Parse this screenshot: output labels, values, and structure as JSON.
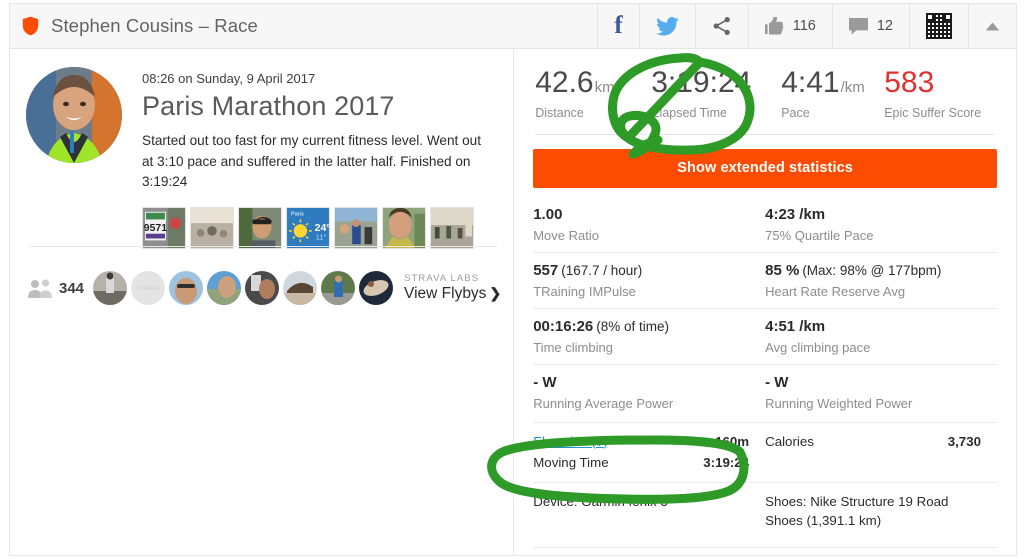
{
  "header": {
    "shield_icon": "shield-icon",
    "title": "Stephen Cousins – Race",
    "facebook_icon": "facebook-icon",
    "twitter_icon": "twitter-icon",
    "share_icon": "share-icon",
    "kudos_icon": "thumbs-up-icon",
    "kudos_count": "116",
    "comment_icon": "comment-icon",
    "comment_count": "12",
    "qr_icon": "qr-code-icon",
    "collapse_icon": "chevron-up-icon"
  },
  "activity": {
    "date": "08:26 on Sunday, 9 April 2017",
    "title": "Paris Marathon 2017",
    "description": "Started out too fast for my current fitness level. Went out at 3:10 pace and suffered in the latter half. Finished on 3:19:24",
    "avatar": "athlete-avatar",
    "photos": [
      {
        "name": "photo-race-bib"
      },
      {
        "name": "photo-street-crowd"
      },
      {
        "name": "photo-selfie-cap"
      },
      {
        "name": "photo-weather-widget"
      },
      {
        "name": "photo-runners"
      },
      {
        "name": "photo-medal-selfie"
      },
      {
        "name": "photo-finish-line"
      }
    ]
  },
  "flybys": {
    "people_icon": "people-icon",
    "count": "344",
    "avatars": [
      {
        "name": "flyby-avatar-1"
      },
      {
        "name": "flyby-avatar-2"
      },
      {
        "name": "flyby-avatar-3"
      },
      {
        "name": "flyby-avatar-4"
      },
      {
        "name": "flyby-avatar-5"
      },
      {
        "name": "flyby-avatar-6"
      },
      {
        "name": "flyby-avatar-7"
      },
      {
        "name": "flyby-avatar-8"
      }
    ],
    "kicker": "STRAVA LABS",
    "label": "View Flybys",
    "chevron": "❯"
  },
  "summary": [
    {
      "value": "42.6",
      "unit": "km",
      "label": "Distance",
      "red": false
    },
    {
      "value": "3:19:24",
      "unit": "",
      "label": "Elapsed Time",
      "red": false
    },
    {
      "value": "4:41",
      "unit": "/km",
      "label": "Pace",
      "red": false
    },
    {
      "value": "583",
      "unit": "",
      "label": "Epic Suffer Score",
      "red": true
    }
  ],
  "extended_button": "Show extended statistics",
  "stats": [
    [
      {
        "value": "1.00",
        "sub": "",
        "label": "Move Ratio"
      },
      {
        "value": "4:23 /km",
        "sub": "",
        "label": "75% Quartile Pace"
      }
    ],
    [
      {
        "value": "557",
        "sub": "(167.7 / hour)",
        "label": "TRaining IMPulse"
      },
      {
        "value": "85 %",
        "sub": "(Max: 98% @ 177bpm)",
        "label": "Heart Rate Reserve Avg"
      }
    ],
    [
      {
        "value": "00:16:26",
        "sub": "(8% of time)",
        "label": "Time climbing"
      },
      {
        "value": "4:51 /km",
        "sub": "",
        "label": "Avg climbing pace"
      }
    ],
    [
      {
        "value": "- W",
        "sub": "",
        "label": "Running Average Power"
      },
      {
        "value": "- W",
        "sub": "",
        "label": "Running Weighted Power"
      }
    ]
  ],
  "details": {
    "left": [
      {
        "key": "Elevation (?)",
        "value": "160m",
        "link": true
      },
      {
        "key": "Moving Time",
        "value": "3:19:24",
        "link": false
      }
    ],
    "right": [
      {
        "key": "Calories",
        "value": "3,730",
        "link": false
      }
    ]
  },
  "gear": {
    "device": "Device: Garmin fēnix 3",
    "shoes": "Shoes: Nike Structure 19 Road Shoes (1,391.1 km)"
  },
  "annotations": {
    "color": "#2e9a27",
    "marks": [
      {
        "name": "annotation-circle-elapsed-time",
        "target": "Elapsed Time"
      },
      {
        "name": "annotation-circle-moving-time",
        "target": "Moving Time"
      }
    ]
  },
  "colors": {
    "brand_orange": "#fc4c02",
    "suffer_red": "#e03131",
    "link_blue": "#1c93d6",
    "annotation_green": "#2e9a27"
  }
}
